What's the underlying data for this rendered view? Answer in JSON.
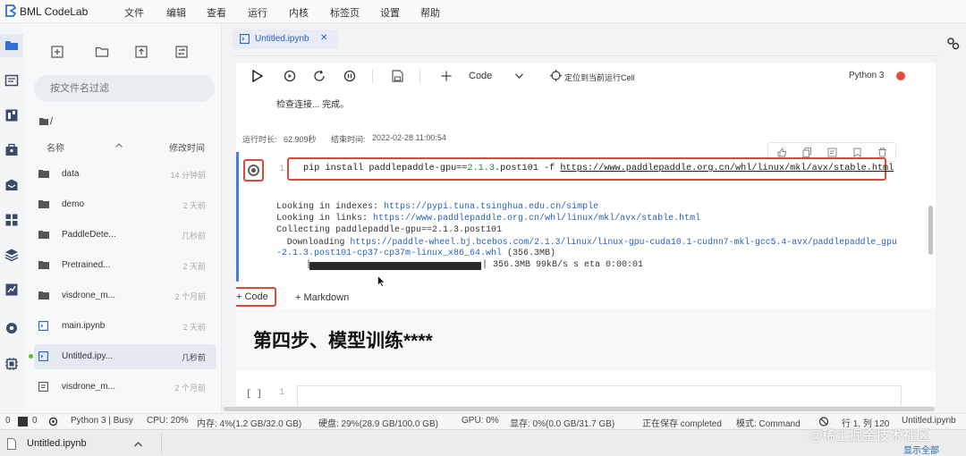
{
  "app": {
    "brand": "BML CodeLab"
  },
  "menu": [
    "文件",
    "编辑",
    "查看",
    "运行",
    "内核",
    "标签页",
    "设置",
    "帮助"
  ],
  "filebrowser": {
    "search_placeholder": "按文件名过滤",
    "path": "/",
    "col_name": "名称",
    "col_modified": "修改时间",
    "files": [
      {
        "name": "data",
        "time": "14 分钟前",
        "type": "folder"
      },
      {
        "name": "demo",
        "time": "2 天前",
        "type": "folder"
      },
      {
        "name": "PaddleDete...",
        "time": "几秒前",
        "type": "folder"
      },
      {
        "name": "Pretrained...",
        "time": "2 天前",
        "type": "folder"
      },
      {
        "name": "visdrone_m...",
        "time": "2 个月前",
        "type": "folder"
      },
      {
        "name": "main.ipynb",
        "time": "2 天前",
        "type": "notebook"
      },
      {
        "name": "Untitled.ipy...",
        "time": "几秒前",
        "type": "notebook",
        "selected": true
      },
      {
        "name": "visdrone_m...",
        "time": "2 个月前",
        "type": "file"
      }
    ]
  },
  "tab": {
    "title": "Untitled.ipynb",
    "close": "✕"
  },
  "toolbar": {
    "cell_type": "Code",
    "locate": "定位到当前运行Cell",
    "kernel": "Python 3"
  },
  "notebook": {
    "prev_output": "检查连接... 完成。",
    "run_time_label": "运行时长:",
    "run_time": "62.909秒",
    "end_time_label": "结束时间:",
    "end_time": "2022-02-28 11:00:54",
    "cell_number": "1",
    "cmd_pre": "pip install paddlepaddle-gpu==",
    "cmd_ver": "2.1.3",
    "cmd_mid": ".post101 -f ",
    "cmd_url": "https://www.paddlepaddle.org.cn/whl/linux/mkl/avx/stable.html",
    "out1_pre": "Looking in indexes: ",
    "out1_link": "https://pypi.tuna.tsinghua.edu.cn/simple",
    "out2_pre": "Looking in links: ",
    "out2_link": "https://www.paddlepaddle.org.cn/whl/linux/mkl/avx/stable.html",
    "out3": "Collecting paddlepaddle-gpu==2.1.3.post101",
    "out4_pre": "  Downloading ",
    "out4_link": "https://paddle-wheel.bj.bcebos.com/2.1.3/linux/linux-gpu-cuda10.1-cudnn7-mkl-gcc5.4-avx/paddlepaddle_gpu",
    "out5_link": "-2.1.3.post101-cp37-cp37m-linux_x86_64.whl",
    "out5_post": " (356.3MB)",
    "progress_left": "|",
    "progress_right": "| 356.3MB 99kB/s s eta 0:00:01",
    "progress_fraction": 1.0,
    "add_code": "+ Code",
    "add_markdown": "+ Markdown",
    "heading": "第四步、模型训练****",
    "empty_cell_prompt": "[ ]",
    "empty_cell_number": "1"
  },
  "statusbar": {
    "s1": "0",
    "s2": "0",
    "kernel": "Python 3 | Busy",
    "cpu": "CPU:  20%",
    "mem": "内存:  4%(1.2 GB/32.0 GB)",
    "disk": "硬盘:  29%(28.9 GB/100.0 GB)",
    "gpu": "GPU:  0%",
    "vram": "显存:  0%(0.0 GB/31.7 GB)",
    "saving": "正在保存 completed",
    "mode": "模式:  Command",
    "cursor": "行 1, 列 120",
    "file": "Untitled.ipynb"
  },
  "downloads": {
    "item": "Untitled.ipynb",
    "show_all": "显示全部"
  },
  "watermark": "@稀土掘金技术社区",
  "colors": {
    "accent": "#d94a38",
    "link": "#2663b9",
    "kernel_dot": "#e64a3b",
    "modified_dot": "#52c41a"
  }
}
